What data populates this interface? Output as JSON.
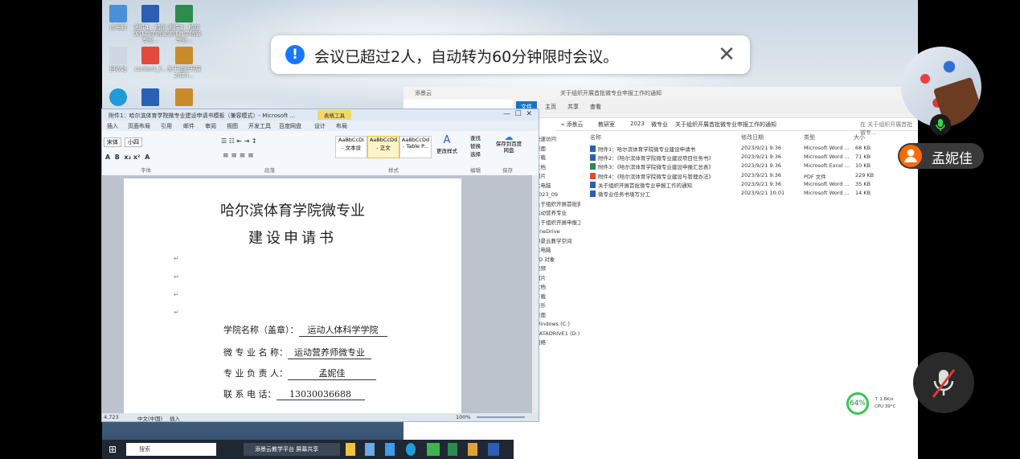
{
  "notification": {
    "text": "会议已超过2人，自动转为60分钟限时会议。",
    "info_icon": "!",
    "close_icon": "✕"
  },
  "participant": {
    "name": "孟妮佳",
    "avatar_icon": "user-icon"
  },
  "desktop": {
    "icons": [
      {
        "label": "此电脑"
      },
      {
        "label": "附件1：哈尔滨体育学院微专业..."
      },
      {
        "label": "附件3：哈尔滨体育学院微专业..."
      },
      {
        "label": "回收站"
      },
      {
        "label": "content_f..."
      },
      {
        "label": "关于组织开展2023..."
      },
      {
        "label": "Microsoft Edge"
      },
      {
        "label": "附件..."
      },
      {
        "label": "附件..."
      }
    ]
  },
  "word": {
    "title": "附件1：哈尔滨体育学院微专业建设申请书模板（兼容模式）- Microsoft ...",
    "context_tab": "表格工具",
    "tabs": [
      "插入",
      "页面布局",
      "引用",
      "邮件",
      "审阅",
      "视图",
      "开发工具",
      "百度网盘",
      "设计",
      "布局"
    ],
    "font_name": "宋体",
    "font_size": "小四",
    "styles": [
      {
        "sample": "AaBbCcDi",
        "label": "- 文本设"
      },
      {
        "sample": "AaBbCcDd",
        "label": "- 正文"
      },
      {
        "sample": "AaBbCcDd",
        "label": "- Table P..."
      }
    ],
    "change_styles": "更改样式",
    "find": "查找",
    "replace": "替换",
    "select": "选择",
    "save_baidu": "保存到百度网盘",
    "groups": [
      "字体",
      "段落",
      "样式",
      "编辑",
      "保存"
    ],
    "doc_title_line1": "哈尔滨体育学院微专业",
    "doc_title_line2": "建设申请书",
    "fields": [
      {
        "label": "学院名称（盖章）：",
        "value": "运动人体科学学院"
      },
      {
        "label": "微 专 业 名 称：",
        "value": "运动营养师微专业"
      },
      {
        "label": "专 业 负 责 人：",
        "value": "孟妮佳"
      },
      {
        "label": "联 系 电 话：",
        "value": "13030036688"
      }
    ],
    "status_words": "4,723",
    "status_lang": "中文(中国)",
    "status_mode": "插入",
    "zoom": "100%"
  },
  "explorer": {
    "window_title": "关于组织开展首批微专业申报工作的通知",
    "app_tab": "添景云",
    "ribbon_tabs": [
      "文件",
      "主页",
      "共享",
      "查看"
    ],
    "breadcrumb": [
      "« 添景云",
      "教研室",
      "2023",
      "微专业",
      "关于组织开展首批微专业申报工作的通知"
    ],
    "search_placeholder": "在 关于组织开展首批微专...",
    "columns": [
      "名称",
      "修改日期",
      "类型",
      "大小"
    ],
    "files": [
      {
        "name": "附件1：哈尔滨体育学院微专业建设申请书",
        "date": "2023/9/21 9:36",
        "type": "Microsoft Word ...",
        "size": "68 KB"
      },
      {
        "name": "附件2：《哈尔滨体育学院微专业建设项目任务书》",
        "date": "2023/9/21 9:36",
        "type": "Microsoft Word ...",
        "size": "71 KB"
      },
      {
        "name": "附件3：《哈尔滨体育学院微专业建设申报汇总表》",
        "date": "2023/9/21 9:36",
        "type": "Microsoft Excel ...",
        "size": "10 KB"
      },
      {
        "name": "附件4：《哈尔滨体育学院微专业建设与管理办法》",
        "date": "2023/9/21 9:36",
        "type": "PDF 文件",
        "size": "229 KB"
      },
      {
        "name": "关于组织开展首批微专业申报工作的通知",
        "date": "2023/9/21 9:36",
        "type": "Microsoft Word ...",
        "size": "35 KB"
      },
      {
        "name": "微专业任务书填写分工",
        "date": "2023/9/21 10:01",
        "type": "Microsoft Word ...",
        "size": "14 KB"
      }
    ],
    "nav": [
      "快速访问",
      "桌面",
      "下载",
      "文档",
      "图片",
      "此电脑",
      "2023_09",
      "关于组织开展首批微",
      "运动营养专业",
      "关于组织开展申报工作的",
      "OneDrive",
      "添景云教学空间",
      "此电脑",
      "3D 对象",
      "视频",
      "图片",
      "文档",
      "下载",
      "音乐",
      "桌面",
      "Windows (C:)",
      "DATADRIVE1 (D:)",
      "网络"
    ]
  },
  "taskbar": {
    "search": "搜索",
    "tray": "添景云教学平台 屏幕共享"
  },
  "perf": {
    "percent": "64%",
    "net": "↑ 1.6K/s",
    "cpu": "CPU 39°C"
  }
}
